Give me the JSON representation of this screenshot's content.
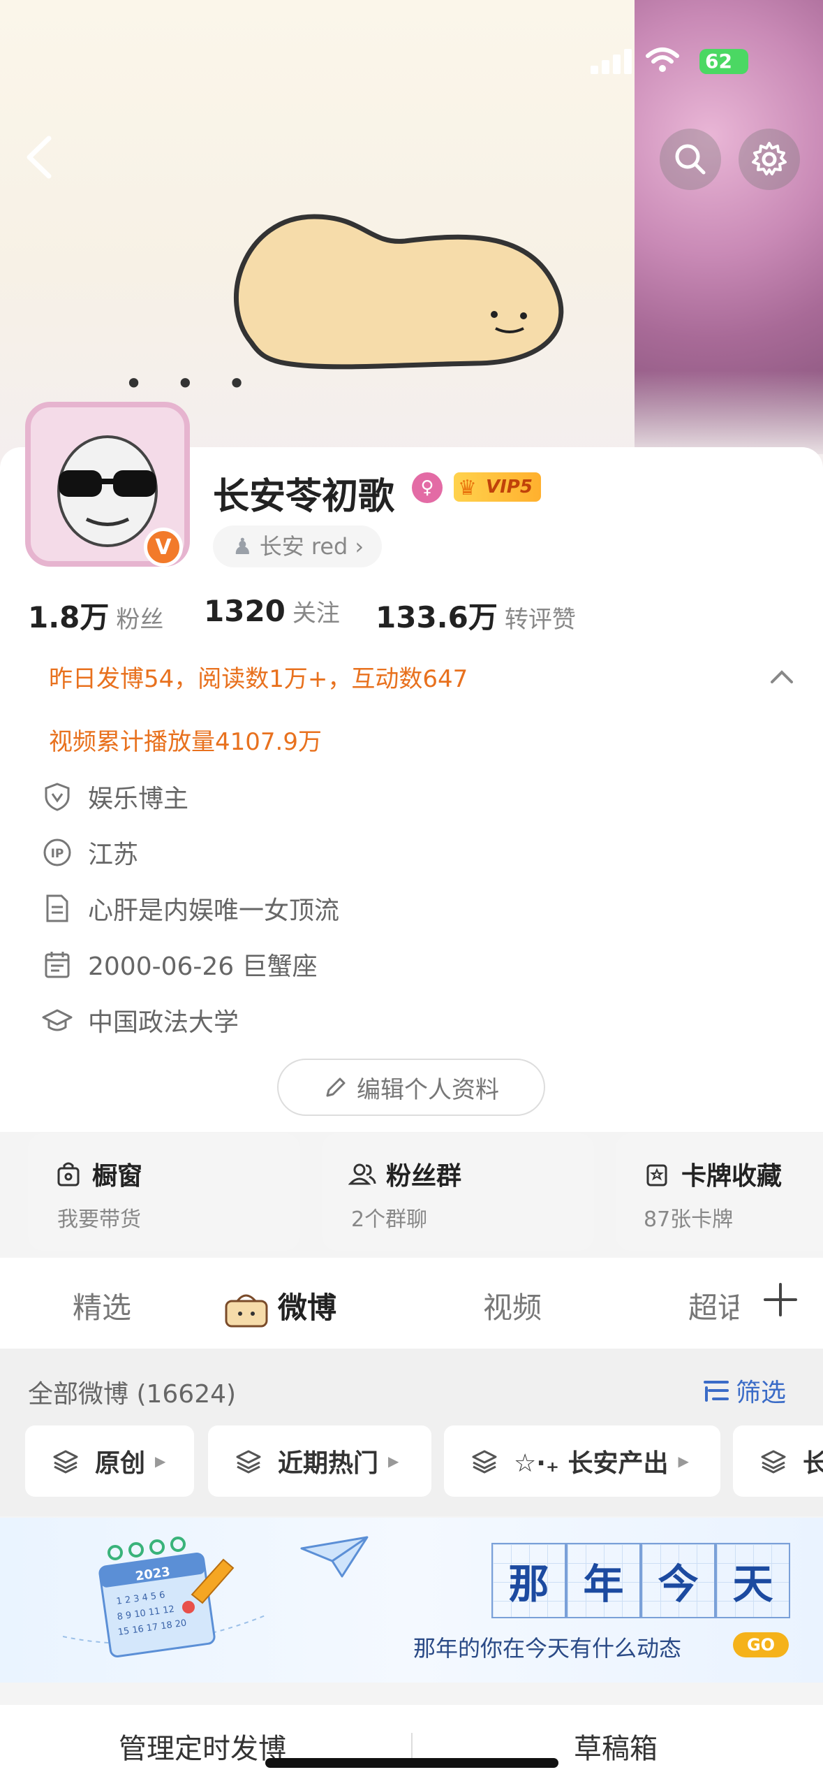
{
  "status_bar": {
    "battery": "62"
  },
  "profile": {
    "name": "长安苓初歌",
    "vip_label": "VIP5",
    "verified_mark": "V",
    "tag": "长安 red",
    "stats": [
      {
        "value": "1.8万",
        "label": "粉丝"
      },
      {
        "value": "1320",
        "label": "关注"
      },
      {
        "value": "133.6万",
        "label": "转评赞"
      }
    ],
    "highlights": [
      "昨日发博54，阅读数1万+，互动数647",
      "视频累计播放量4107.9万"
    ],
    "info": [
      {
        "icon": "shield-icon",
        "text": "娱乐博主"
      },
      {
        "icon": "ip-icon",
        "text": "江苏"
      },
      {
        "icon": "document-icon",
        "text": "心肝是内娱唯一女顶流"
      },
      {
        "icon": "calendar-icon",
        "text": "2000-06-26 巨蟹座"
      },
      {
        "icon": "graduation-cap-icon",
        "text": "中国政法大学"
      }
    ],
    "edit_button": "编辑个人资料"
  },
  "features": [
    {
      "title": "橱窗",
      "sub": "我要带货"
    },
    {
      "title": "粉丝群",
      "sub": "2个群聊"
    },
    {
      "title": "卡牌收藏",
      "sub": "87张卡牌"
    }
  ],
  "tabs": [
    "精选",
    "微博",
    "视频",
    "超话"
  ],
  "feed": {
    "count_label": "全部微博 (16624)",
    "filter_label": "筛选",
    "chips": [
      "原创",
      "近期热门",
      "☆·₊ 长安产出",
      "长"
    ]
  },
  "banner": {
    "title_chars": [
      "那",
      "年",
      "今",
      "天"
    ],
    "calendar_year": "2023",
    "subtitle": "那年的你在今天有什么动态",
    "go_label": "GO"
  },
  "bottom_bar": {
    "left": "管理定时发博",
    "right": "草稿箱"
  }
}
